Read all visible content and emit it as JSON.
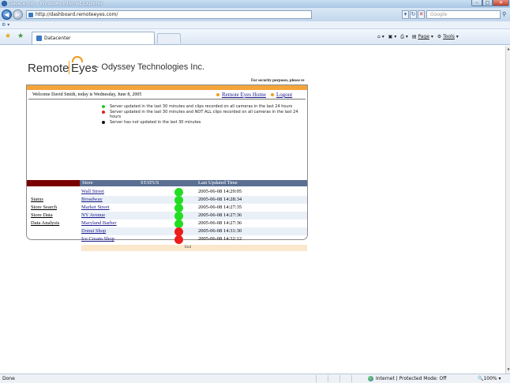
{
  "browser": {
    "window_title": "Datacenter - Windows Internet Explorer",
    "url": "http://dashboard.remoteeyes.com/",
    "search_placeholder": "Google",
    "tab_title": "Datacenter",
    "commands": {
      "page": "Page",
      "tools": "Tools"
    },
    "status_text": "Done",
    "zone": "Internet | Protected Mode: Off",
    "zoom": "100%"
  },
  "page": {
    "logo_left": "Remote",
    "logo_right": "Eyes",
    "company": "--   Odyssey Technologies Inc.",
    "security_note": "For security purposes, please re",
    "welcome": "Welcome David Smith, today is Wednesday, June 8, 2005",
    "home_link": "Remote Eyes Home",
    "logout_link": "Logout",
    "legend": [
      {
        "color": "#22cc22",
        "text": "Server updated in the last 30 minutes and clips recorded on all cameras in the last 24 hours"
      },
      {
        "color": "#e02020",
        "text": "Server updated in the last 30 minutes and NOT ALL clips recorded on all cameras in the last 24 hours"
      },
      {
        "color": "#111111",
        "text": "Server has not updated in the last 30 minutes"
      }
    ],
    "table_headers": {
      "store": "Store",
      "status": "STATUS",
      "updated": "Last Updated Time"
    },
    "side_menu": [
      "Status",
      "Store Search",
      "Store Data",
      "Data Analysis"
    ],
    "rows": [
      {
        "store": "Wall Street",
        "status": "green",
        "time": "2005-06-08 14:29:05"
      },
      {
        "store": "Broadway",
        "status": "green",
        "time": "2005-06-08 14:28:34"
      },
      {
        "store": "Market Street",
        "status": "green",
        "time": "2005-06-08 14:27:35"
      },
      {
        "store": "NY Avenue",
        "status": "green",
        "time": "2005-06-08 14:27:36"
      },
      {
        "store": "Maryland Barber",
        "status": "green",
        "time": "2005-06-08 14:27:36"
      },
      {
        "store": "Donut Shop",
        "status": "red",
        "time": "2005-06-08 14:31:30"
      },
      {
        "store": "Ice Cream Shop",
        "status": "red",
        "time": "2005-06-08 14:32:12"
      }
    ],
    "end_label": "End",
    "status_colors": {
      "green": "#22dd22",
      "red": "#ee1c1c"
    }
  }
}
